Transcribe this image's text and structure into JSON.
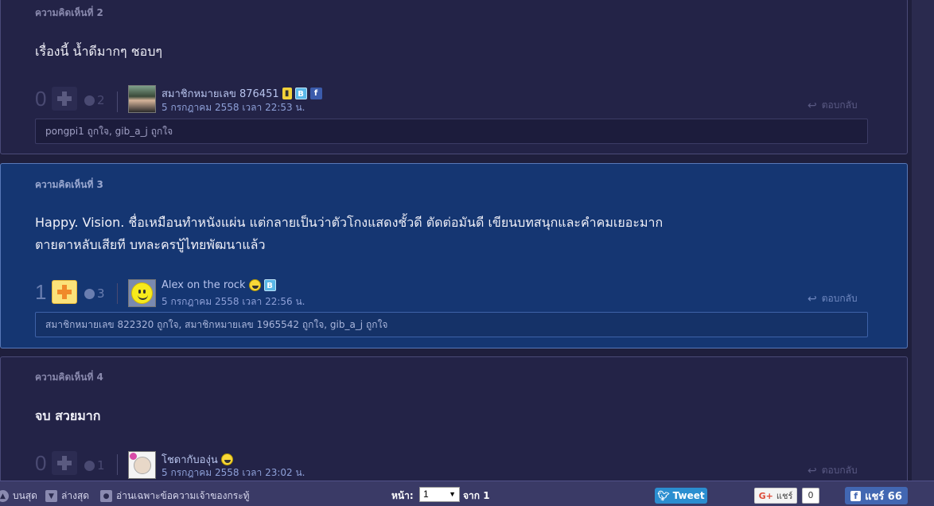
{
  "comments": [
    {
      "number_label": "ความคิดเห็นที่ 2",
      "body_lines": [
        "เรื่องนี้ น้ำดีมากๆ ชอบๆ"
      ],
      "votes": "0",
      "emotion_count": "2",
      "user_name": "สมาชิกหมายเลข 876451",
      "date": "5 กรกฎาคม 2558 เวลา 22:53 น.",
      "reply_label": "ตอบกลับ",
      "likes": "pongpi1 ถูกใจ, gib_a_j ถูกใจ"
    },
    {
      "number_label": "ความคิดเห็นที่ 3",
      "body_lines": [
        "Happy. Vision. ชื่อเหมือนทำหนังแผ่น แต่กลายเป็นว่าตัวโกงแสดงชั้วดี ตัดต่อมันดี เขียนบทสนุกและคำคมเยอะมาก",
        "ตายตาหลับเสียที บทละครบู้ไทยพัฒนาแล้ว"
      ],
      "votes": "1",
      "emotion_count": "3",
      "user_name": "Alex on the rock",
      "date": "5 กรกฎาคม 2558 เวลา 22:56 น.",
      "reply_label": "ตอบกลับ",
      "likes": "สมาชิกหมายเลข 822320 ถูกใจ, สมาชิกหมายเลข 1965542 ถูกใจ, gib_a_j ถูกใจ"
    },
    {
      "number_label": "ความคิดเห็นที่ 4",
      "body_lines": [
        "จบ สวยมาก"
      ],
      "votes": "0",
      "emotion_count": "1",
      "user_name": "โชดากับองุ่น",
      "date": "5 กรกฎาคม 2558 เวลา 23:02 น.",
      "reply_label": "ตอบกลับ"
    }
  ],
  "bottom_bar": {
    "top_label": "บนสุด",
    "bottom_label": "ล่างสุด",
    "owner_only_label": "อ่านเฉพาะข้อความเจ้าของกระทู้",
    "page_label": "หน้า:",
    "page_value": "1",
    "page_of": "จาก 1",
    "tweet_label": "Tweet",
    "gplus_label": "แชร์",
    "gplus_count": "0",
    "fb_label": "แชร์ 66"
  },
  "colors": {
    "background": "#1f1f3d",
    "highlight_card": "#153672",
    "vote_active": "#fbe27a",
    "tweet": "#2b8ed0",
    "facebook": "#4267b2"
  }
}
